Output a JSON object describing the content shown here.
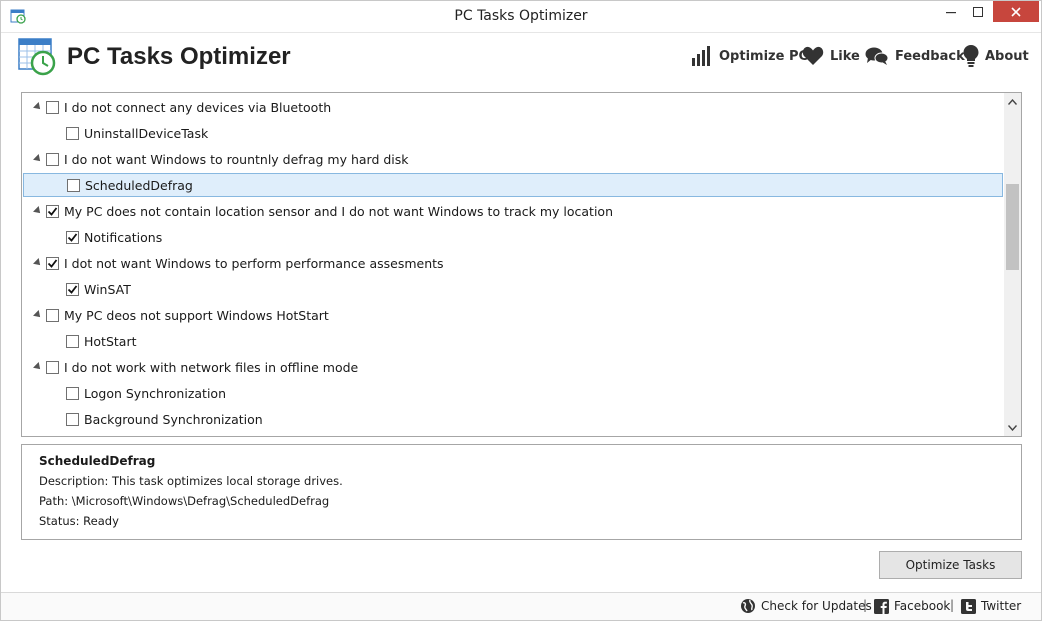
{
  "window": {
    "title": "PC Tasks Optimizer",
    "minimize_glyph": "—",
    "maximize_glyph": "☐",
    "close_glyph": "✕"
  },
  "header": {
    "brand": "PC Tasks Optimizer",
    "nav": [
      {
        "label": "Optimize PC",
        "icon": "bar-chart-icon"
      },
      {
        "label": "Like",
        "icon": "heart-icon"
      },
      {
        "label": "Feedback",
        "icon": "chat-bubbles-icon"
      },
      {
        "label": "About",
        "icon": "lightbulb-icon"
      }
    ]
  },
  "tasks": {
    "rows": [
      {
        "type": "group",
        "label": "I do not connect any devices via Bluetooth",
        "checked": false
      },
      {
        "type": "task",
        "label": "UninstallDeviceTask",
        "checked": false
      },
      {
        "type": "group",
        "label": "I do not want Windows to rountnly defrag my hard disk",
        "checked": false
      },
      {
        "type": "task",
        "label": "ScheduledDefrag",
        "checked": false,
        "selected": true
      },
      {
        "type": "group",
        "label": "My PC does not contain location sensor and I do not want Windows to track my location",
        "checked": true
      },
      {
        "type": "task",
        "label": "Notifications",
        "checked": true
      },
      {
        "type": "group",
        "label": "I dot not want Windows to perform performance assesments",
        "checked": true
      },
      {
        "type": "task",
        "label": "WinSAT",
        "checked": true
      },
      {
        "type": "group",
        "label": "My PC deos not support Windows HotStart",
        "checked": false
      },
      {
        "type": "task",
        "label": "HotStart",
        "checked": false
      },
      {
        "type": "group",
        "label": "I do not work with network files in offline mode",
        "checked": false
      },
      {
        "type": "task",
        "label": "Logon Synchronization",
        "checked": false
      },
      {
        "type": "task",
        "label": "Background Synchronization",
        "checked": false
      }
    ]
  },
  "details": {
    "title": "ScheduledDefrag",
    "description": "Description: This task optimizes local storage drives.",
    "path": "Path: \\Microsoft\\Windows\\Defrag\\ScheduledDefrag",
    "status": "Status: Ready"
  },
  "actions": {
    "optimize_label": "Optimize Tasks"
  },
  "footer": {
    "updates_label": "Check for Updates",
    "facebook_label": "Facebook",
    "twitter_label": "Twitter",
    "separator": "|"
  },
  "colors": {
    "selection_bg": "#dfeefb",
    "selection_border": "#88b8e0",
    "close_button": "#c7463d",
    "logo_green": "#3aa24a",
    "logo_blue": "#3b7ec7"
  }
}
